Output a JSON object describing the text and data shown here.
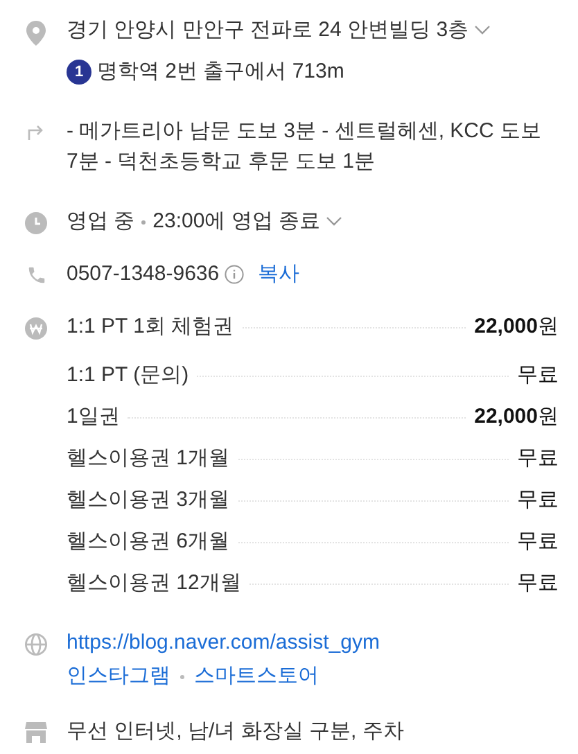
{
  "address": {
    "text": "경기 안양시 만안구 전파로 24 안변빌딩 3층",
    "expanded": false
  },
  "subway": {
    "line": "1",
    "color": "#283593",
    "text": "명학역 2번 출구에서 713m"
  },
  "directions": "- 메가트리아 남문 도보 3분 - 센트럴헤센, KCC 도보 7분 - 덕천초등학교 후문 도보 1분",
  "hours": {
    "status": "영업 중",
    "closing": "23:00에 영업 종료",
    "expanded": false
  },
  "phone": {
    "number": "0507-1348-9636",
    "copy": "복사"
  },
  "prices": [
    {
      "name": "1:1 PT 1회 체험권",
      "price": "**22,000**원"
    },
    {
      "name": "1:1 PT (문의)",
      "price": "무료"
    },
    {
      "name": "1일권",
      "price": "**22,000**원"
    },
    {
      "name": "헬스이용권 1개월",
      "price": "무료"
    },
    {
      "name": "헬스이용권 3개월",
      "price": "무료"
    },
    {
      "name": "헬스이용권 6개월",
      "price": "무료"
    },
    {
      "name": "헬스이용권 12개월",
      "price": "무료"
    }
  ],
  "website": {
    "url": "https://blog.naver.com/assist_gym",
    "links": [
      "인스타그램",
      "스마트스토어"
    ]
  },
  "amenities": "무선 인터넷, 남/녀 화장실 구분, 주차"
}
